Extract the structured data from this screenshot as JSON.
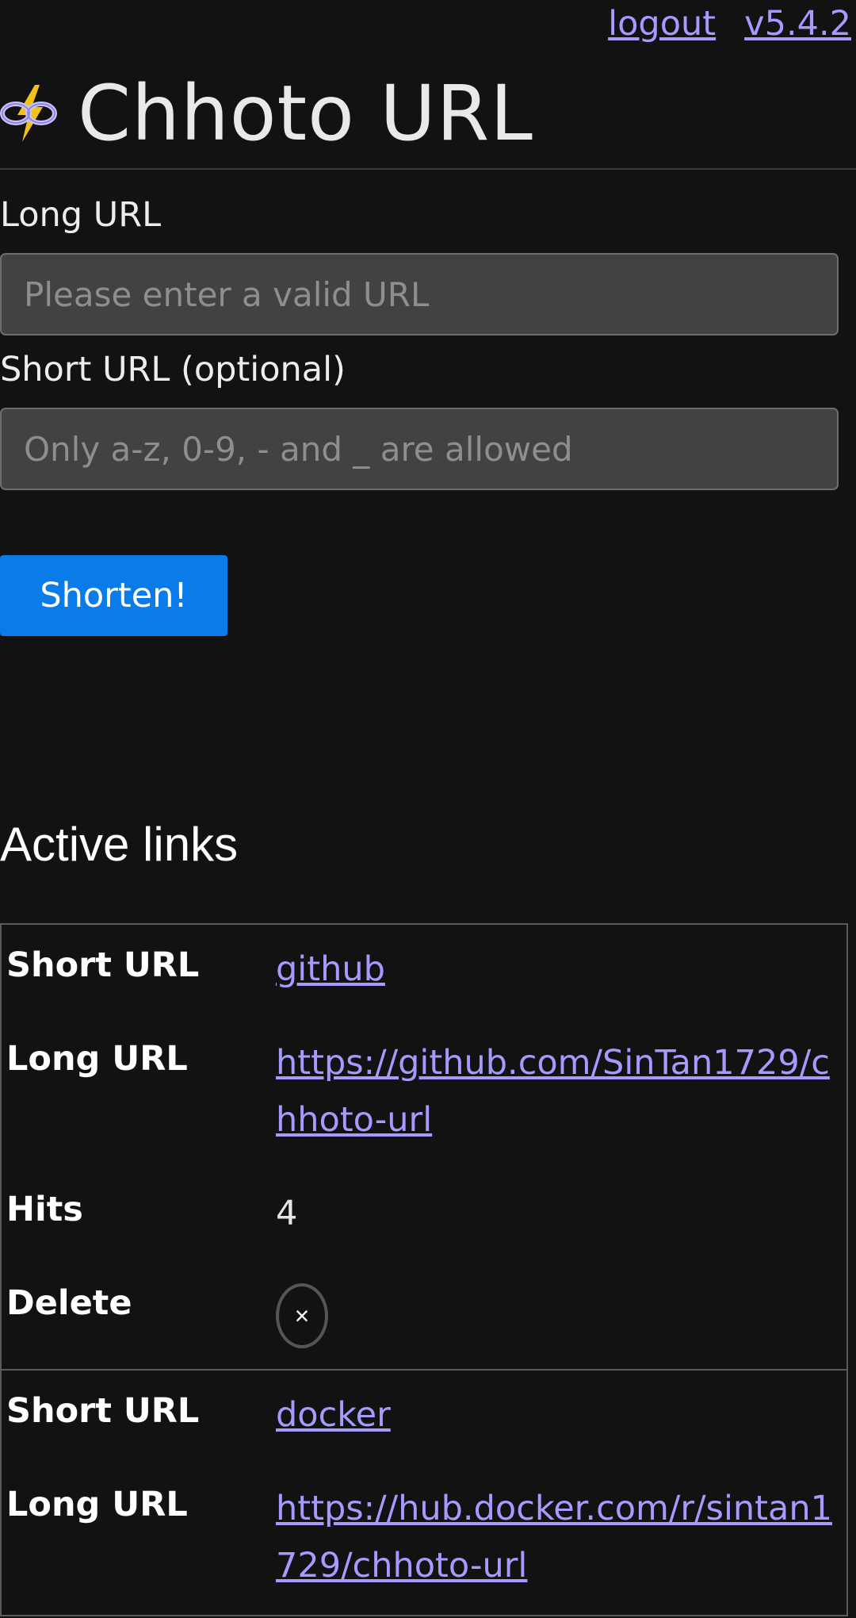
{
  "topbar": {
    "logout_label": "logout",
    "version_label": "v5.4.2"
  },
  "header": {
    "title": "Chhoto URL",
    "logo_icon": "chain-link-lightning-icon"
  },
  "form": {
    "long_url_label": "Long URL",
    "long_url_placeholder": "Please enter a valid URL",
    "short_url_label": "Short URL (optional)",
    "short_url_placeholder": "Only a-z, 0-9, - and _ are allowed",
    "submit_label": "Shorten!"
  },
  "links": {
    "title": "Active links",
    "row_labels": {
      "short": "Short URL",
      "long": "Long URL",
      "hits": "Hits",
      "delete": "Delete"
    },
    "delete_icon": "×",
    "items": [
      {
        "short": "github",
        "long": "https://github.com/SinTan1729/chhoto-url",
        "hits": "4"
      },
      {
        "short": "docker",
        "long": "https://hub.docker.com/r/sintan1729/chhoto-url"
      }
    ]
  },
  "colors": {
    "accent": "#0a7cea",
    "link": "#a59bff",
    "background": "#121212"
  }
}
